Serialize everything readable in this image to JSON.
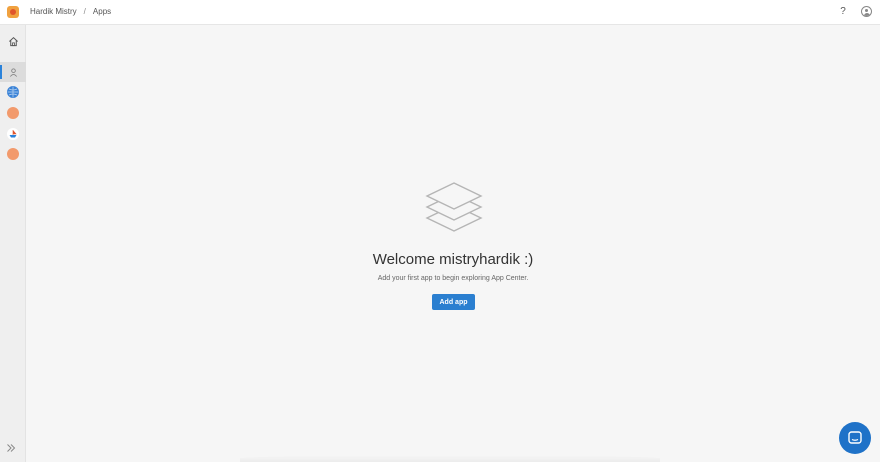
{
  "breadcrumb": [
    "Hardik Mistry",
    "Apps"
  ],
  "breadcrumb_separator": "/",
  "topbar": {
    "help_label": "?"
  },
  "sidebar": {
    "items": [
      {
        "name": "home-icon"
      },
      {
        "name": "person-icon",
        "active": true
      },
      {
        "name": "org-avatar-globe",
        "color": "#3a82d6"
      },
      {
        "name": "org-avatar-orange",
        "color": "#f29a6c"
      },
      {
        "name": "org-avatar-ship",
        "color": "#e0552d"
      },
      {
        "name": "org-avatar-orange-2",
        "color": "#f29a6c"
      }
    ],
    "expand_icon": "double-chevron-right-icon"
  },
  "main": {
    "welcome": "Welcome mistryhardik :)",
    "subtitle": "Add your first app to begin exploring App Center.",
    "add_button": "Add app"
  },
  "colors": {
    "accent": "#2b7fd0",
    "chat": "#1f72c8"
  }
}
